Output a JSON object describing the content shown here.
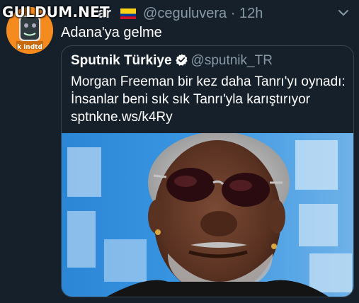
{
  "watermark": "GULDUM.NET",
  "tweet": {
    "author_name": "ar",
    "author_handle": "@ceguluvera",
    "separator": "·",
    "time": "12h",
    "flag_icon": "colombia-flag-icon",
    "text": "Adana'ya gelme",
    "more_icon": "chevron-down-icon",
    "avatar_text": "k indtd"
  },
  "quote": {
    "author_name": "Sputnik Türkiye",
    "author_handle": "@sputnik_TR",
    "verified_icon": "verified-badge-icon",
    "text": "Morgan Freeman bir kez daha Tanrı'yı oynadı: İnsanlar beni sık sık Tanrı'yla karıştırıyor sptnkne.ws/k4Ry",
    "image_icon": "portrait-photo"
  },
  "colors": {
    "background": "#15202b",
    "secondary_text": "#8899a6",
    "border": "#38444d",
    "verified": "#ffffff",
    "avatar": "#f58a1e"
  }
}
